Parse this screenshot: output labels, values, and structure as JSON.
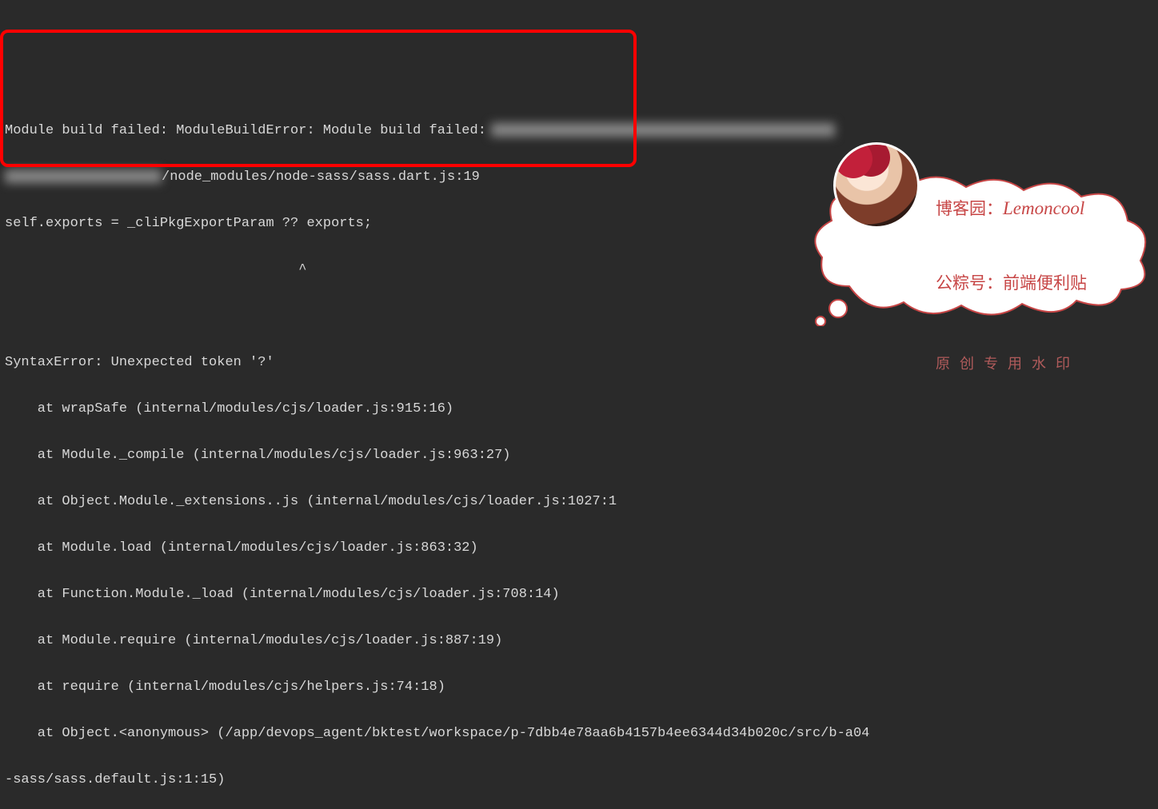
{
  "error": {
    "header": "Module build failed: ModuleBuildError: Module build failed:",
    "file": "/node_modules/node-sass/sass.dart.js:19",
    "codeLine": "self.exports = _cliPkgExportParam ?? exports;",
    "caret": "                                    ^",
    "syntax": "SyntaxError: Unexpected token '?'",
    "stack": [
      "    at wrapSafe (internal/modules/cjs/loader.js:915:16)",
      "    at Module._compile (internal/modules/cjs/loader.js:963:27)",
      "    at Object.Module._extensions..js (internal/modules/cjs/loader.js:1027:1",
      "    at Module.load (internal/modules/cjs/loader.js:863:32)",
      "    at Function.Module._load (internal/modules/cjs/loader.js:708:14)",
      "    at Module.require (internal/modules/cjs/loader.js:887:19)",
      "    at require (internal/modules/cjs/helpers.js:74:18)",
      "    at Object.<anonymous> (/app/devops_agent/bktest/workspace/p-7dbb4e78aa6b4157b4ee6344d34b020c/src/b-a04",
      "-sass/sass.default.js:1:15)"
    ]
  },
  "watermark": {
    "site_label": "博客园：",
    "site_name": "Lemoncool",
    "wechat_label": "公粽号：",
    "wechat_name": "前端便利贴",
    "footer": "原创专用水印"
  }
}
